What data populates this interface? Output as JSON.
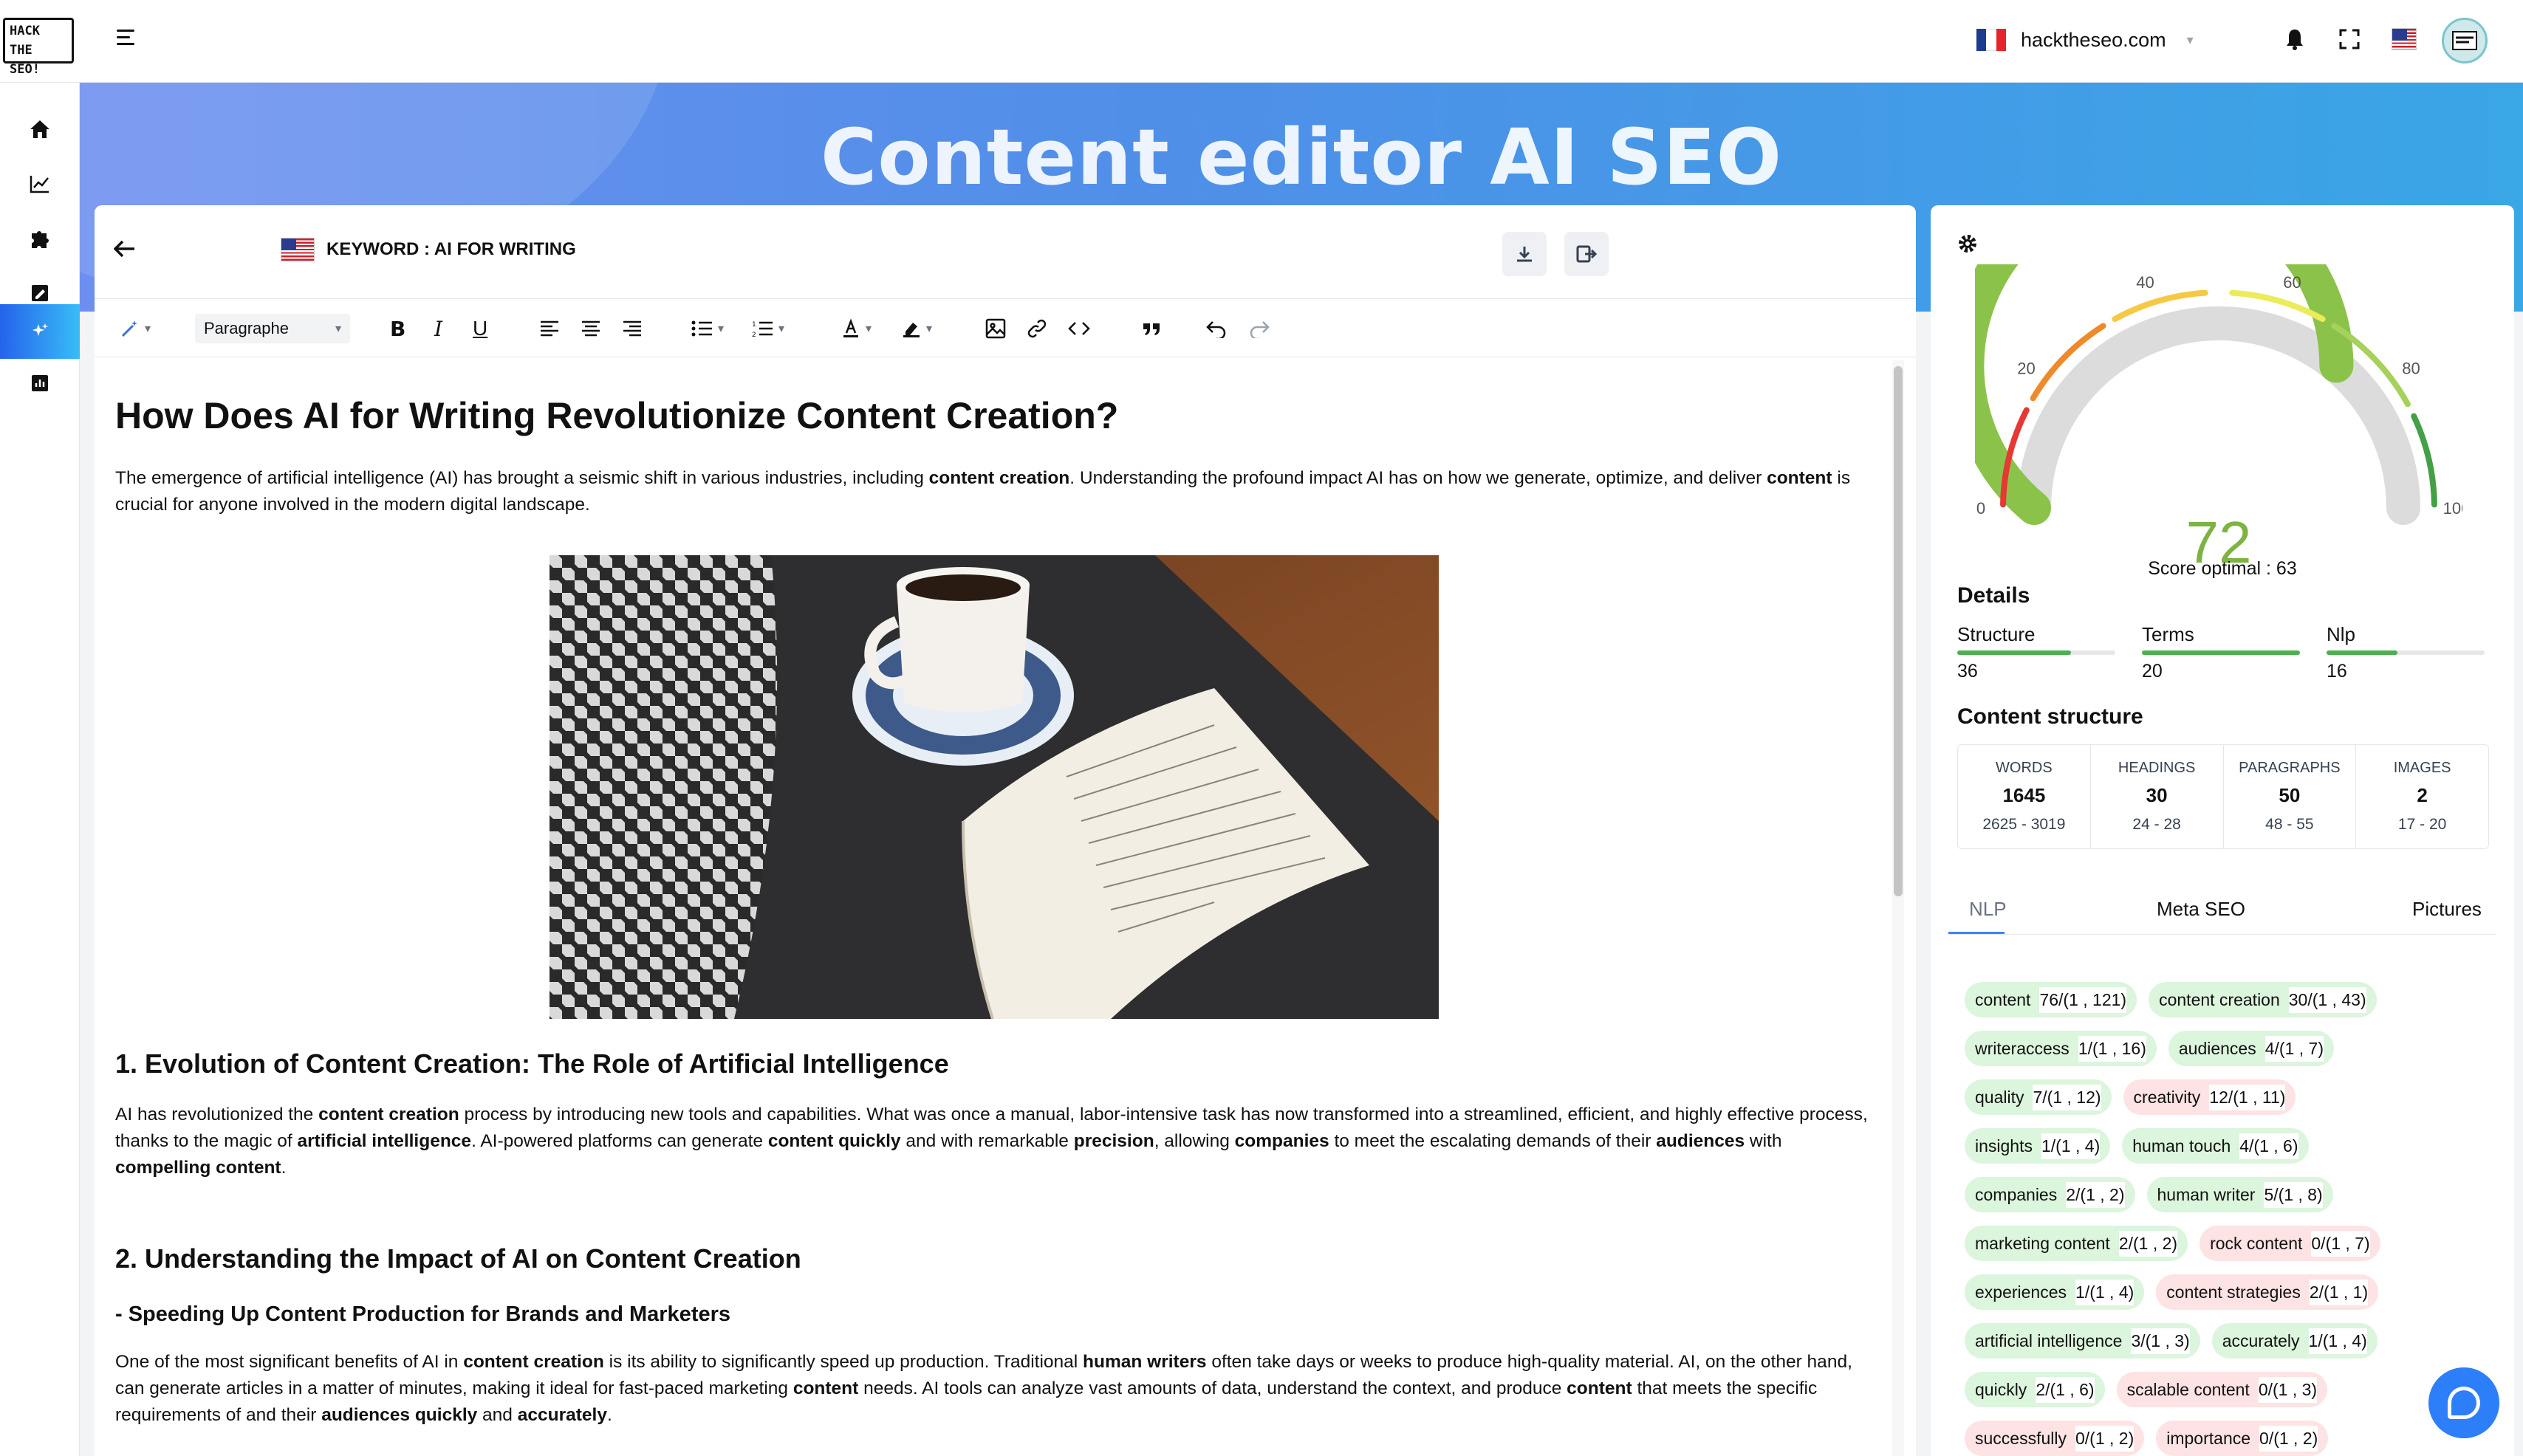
{
  "brand": {
    "logo_line1": "HACK",
    "logo_line2": "THE SEO!"
  },
  "topbar": {
    "site": "hacktheseo.com"
  },
  "banner": {
    "title": "Content editor AI SEO"
  },
  "editor": {
    "keyword": "KEYWORD : AI FOR WRITING",
    "toolbar": {
      "format_select": "Paragraphe"
    },
    "content": {
      "h1": "How Does AI for Writing Revolutionize Content Creation?",
      "intro": [
        {
          "t": "The emergence of artificial intelligence (AI) has brought a seismic shift in various industries, including "
        },
        {
          "b": "content creation"
        },
        {
          "t": ". Understanding the profound impact AI has on how we generate, optimize, and deliver "
        },
        {
          "b": "content"
        },
        {
          "t": " is crucial for anyone involved in the modern digital landscape."
        }
      ],
      "h2_1": "1. Evolution of Content Creation: The Role of Artificial Intelligence",
      "para_1": [
        {
          "t": "AI has revolutionized the "
        },
        {
          "b": "content creation"
        },
        {
          "t": " process by introducing new tools and capabilities. What was once a manual, labor-intensive task has now transformed into a streamlined, efficient, and highly effective process, thanks to the magic of "
        },
        {
          "b": "artificial intelligence"
        },
        {
          "t": ". AI-powered platforms can generate "
        },
        {
          "b": "content quickly"
        },
        {
          "t": " and with remarkable "
        },
        {
          "b": "precision"
        },
        {
          "t": ", allowing "
        },
        {
          "b": "companies"
        },
        {
          "t": " to meet the escalating demands of their "
        },
        {
          "b": "audiences"
        },
        {
          "t": " with "
        },
        {
          "b": "compelling content"
        },
        {
          "t": "."
        }
      ],
      "h2_2": "2. Understanding the Impact of AI on Content Creation",
      "h3_1": "- Speeding Up Content Production for Brands and Marketers",
      "para_2": [
        {
          "t": "One of the most significant benefits of AI in "
        },
        {
          "b": "content creation"
        },
        {
          "t": " is its ability to significantly speed up production. Traditional "
        },
        {
          "b": "human writers"
        },
        {
          "t": " often take days or weeks to produce high-quality material. AI, on the other hand, can generate articles in a matter of minutes, making it ideal for fast-paced marketing "
        },
        {
          "b": "content"
        },
        {
          "t": " needs. AI tools can analyze vast amounts of data, understand the context, and produce "
        },
        {
          "b": "content"
        },
        {
          "t": " that meets the specific requirements of and their "
        },
        {
          "b": "audiences quickly"
        },
        {
          "t": " and "
        },
        {
          "b": "accurately"
        },
        {
          "t": "."
        }
      ]
    }
  },
  "score": {
    "value": 72,
    "optimal_label": "Score optimal : 63",
    "min": 0,
    "max": 100,
    "tick_labels": [
      "0",
      "20",
      "40",
      "60",
      "80",
      "100"
    ]
  },
  "details": {
    "title": "Details",
    "items": [
      {
        "label": "Structure",
        "value": "36",
        "fill": 0.72
      },
      {
        "label": "Terms",
        "value": "20",
        "fill": 1.0
      },
      {
        "label": "Nlp",
        "value": "16",
        "fill": 0.45
      }
    ]
  },
  "content_structure": {
    "title": "Content structure",
    "columns": [
      {
        "header": "WORDS",
        "value": "1645",
        "range": "2625 - 3019"
      },
      {
        "header": "HEADINGS",
        "value": "30",
        "range": "24 - 28"
      },
      {
        "header": "PARAGRAPHS",
        "value": "50",
        "range": "48 - 55"
      },
      {
        "header": "IMAGES",
        "value": "2",
        "range": "17 - 20"
      }
    ]
  },
  "tabs": [
    "NLP",
    "Meta SEO",
    "Pictures"
  ],
  "terms": [
    [
      {
        "term": "content",
        "count": "76/(1 , 121)",
        "status": "green"
      },
      {
        "term": "content creation",
        "count": "30/(1 , 43)",
        "status": "green"
      }
    ],
    [
      {
        "term": "writeraccess",
        "count": "1/(1 , 16)",
        "status": "green"
      },
      {
        "term": "audiences",
        "count": "4/(1 , 7)",
        "status": "green"
      }
    ],
    [
      {
        "term": "quality",
        "count": "7/(1 , 12)",
        "status": "green"
      },
      {
        "term": "creativity",
        "count": "12/(1 , 11)",
        "status": "red"
      }
    ],
    [
      {
        "term": "insights",
        "count": "1/(1 , 4)",
        "status": "green"
      },
      {
        "term": "human touch",
        "count": "4/(1 , 6)",
        "status": "green"
      }
    ],
    [
      {
        "term": "companies",
        "count": "2/(1 , 2)",
        "status": "green"
      },
      {
        "term": "human writer",
        "count": "5/(1 , 8)",
        "status": "green"
      }
    ],
    [
      {
        "term": "marketing content",
        "count": "2/(1 , 2)",
        "status": "green"
      },
      {
        "term": "rock content",
        "count": "0/(1 , 7)",
        "status": "red"
      }
    ],
    [
      {
        "term": "experiences",
        "count": "1/(1 , 4)",
        "status": "green"
      },
      {
        "term": "content strategies",
        "count": "2/(1 , 1)",
        "status": "red"
      }
    ],
    [
      {
        "term": "artificial intelligence",
        "count": "3/(1 , 3)",
        "status": "green"
      },
      {
        "term": "accurately",
        "count": "1/(1 , 4)",
        "status": "green"
      }
    ],
    [
      {
        "term": "quickly",
        "count": "2/(1 , 6)",
        "status": "green"
      },
      {
        "term": "scalable content",
        "count": "0/(1 , 3)",
        "status": "red"
      }
    ],
    [
      {
        "term": "successfully",
        "count": "0/(1 , 2)",
        "status": "red"
      },
      {
        "term": "importance",
        "count": "0/(1 , 2)",
        "status": "red"
      }
    ]
  ],
  "colors": {
    "accent": "#2d7ff9",
    "gauge_fill": "#8bc34a",
    "score_text": "#7cb342",
    "chip_green": "#dcf5dd",
    "chip_red": "#fde3e3"
  }
}
